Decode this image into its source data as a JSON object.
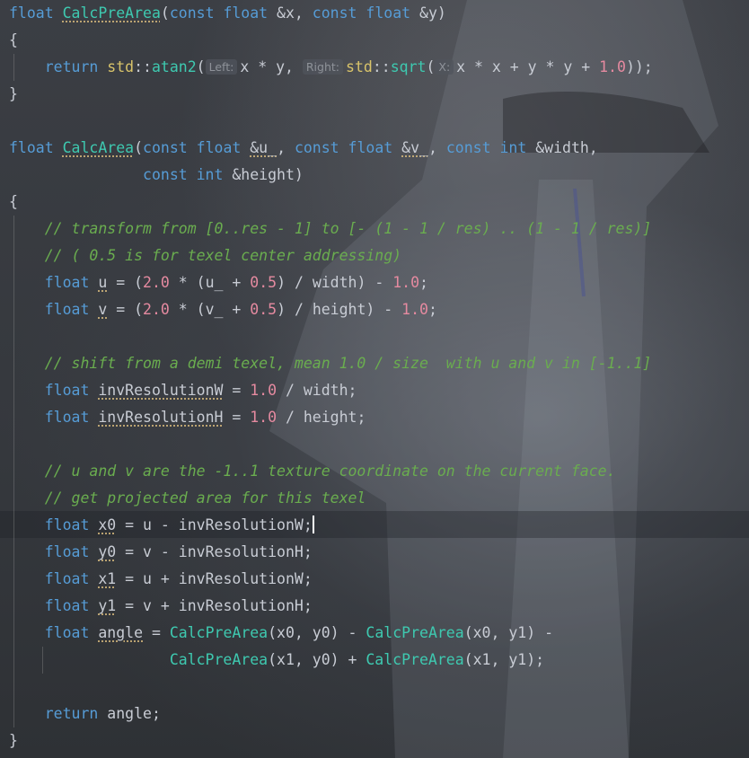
{
  "editor": {
    "language": "C++",
    "cursor_line": 20
  },
  "code": {
    "l1": {
      "kw_float": "float",
      "fn": "CalcPreArea",
      "p1": "(",
      "kw_const1": "const",
      "kw_float2": "float",
      "a": "&x,",
      "kw_const2": "const",
      "kw_float3": "float",
      "b": "&y)"
    },
    "l2": {
      "t": "{"
    },
    "l3": {
      "ret": "return",
      "ns": "std",
      "sep": "::",
      "fn": "atan2",
      "op": "(",
      "hint_left": "Left:",
      "e1": "x * y,",
      "hint_right": "Right:",
      "ns2": "std",
      "sep2": "::",
      "fn2": "sqrt",
      "op2": "(",
      "hint_x": "X:",
      "e2": "x * x + y * y + ",
      "num": "1.0",
      "close": "));"
    },
    "l4": {
      "t": "}"
    },
    "l6": {
      "kw_float": "float",
      "fn": "CalcArea",
      "p": "(",
      "kw_const1": "const",
      "kw_float2": "float",
      "u": "&u_",
      "c1": ",",
      "kw_const2": "const",
      "kw_float3": "float",
      "v": "&v_",
      "c2": ",",
      "kw_const3": "const",
      "kw_int": "int",
      "w": "&width,"
    },
    "l7": {
      "kw_const": "const",
      "kw_int": "int",
      "h": "&height)"
    },
    "l8": {
      "t": "{"
    },
    "l9": {
      "t": "// transform from [0..res - 1] to [- (1 - 1 / res) .. (1 - 1 / res)]"
    },
    "l10": {
      "t": "// ( 0.5 is for texel center addressing)"
    },
    "l11": {
      "kw": "float",
      "var": "u",
      "eq": " = (",
      "n1": "2.0",
      "mid": " * (u_ + ",
      "n2": "0.5",
      "mid2": ") / width) - ",
      "n3": "1.0",
      "end": ";"
    },
    "l12": {
      "kw": "float",
      "var": "v",
      "eq": " = (",
      "n1": "2.0",
      "mid": " * (v_ + ",
      "n2": "0.5",
      "mid2": ") / height) - ",
      "n3": "1.0",
      "end": ";"
    },
    "l14": {
      "t": "// shift from a demi texel, mean 1.0 / size  with u and v in [-1..1]"
    },
    "l15": {
      "kw": "float",
      "var": "invResolutionW",
      "eq": " = ",
      "n": "1.0",
      "end": " / width;"
    },
    "l16": {
      "kw": "float",
      "var": "invResolutionH",
      "eq": " = ",
      "n": "1.0",
      "end": " / height;"
    },
    "l18": {
      "t": "// u and v are the -1..1 texture coordinate on the current face."
    },
    "l19": {
      "t": "// get projected area for this texel"
    },
    "l20": {
      "kw": "float",
      "var": "x0",
      "end": " = u - invResolutionW;"
    },
    "l21": {
      "kw": "float",
      "var": "y0",
      "end": " = v - invResolutionH;"
    },
    "l22": {
      "kw": "float",
      "var": "x1",
      "end": " = u + invResolutionW;"
    },
    "l23": {
      "kw": "float",
      "var": "y1",
      "end": " = v + invResolutionH;"
    },
    "l24": {
      "kw": "float",
      "var": "angle",
      "eq": " = ",
      "f1": "CalcPreArea",
      "a1": "(x0, y0) - ",
      "f2": "CalcPreArea",
      "a2": "(x0, y1) -"
    },
    "l25": {
      "f1": "CalcPreArea",
      "a1": "(x1, y0) + ",
      "f2": "CalcPreArea",
      "a2": "(x1, y1);"
    },
    "l27": {
      "ret": "return",
      "rest": " angle;"
    },
    "l28": {
      "t": "}"
    }
  },
  "colors": {
    "keyword": "#569cd6",
    "function": "#3ec9b0",
    "number": "#e58aa0",
    "comment": "#6aad4f",
    "namespace": "#d9c46a",
    "text": "#c8ccd4"
  }
}
